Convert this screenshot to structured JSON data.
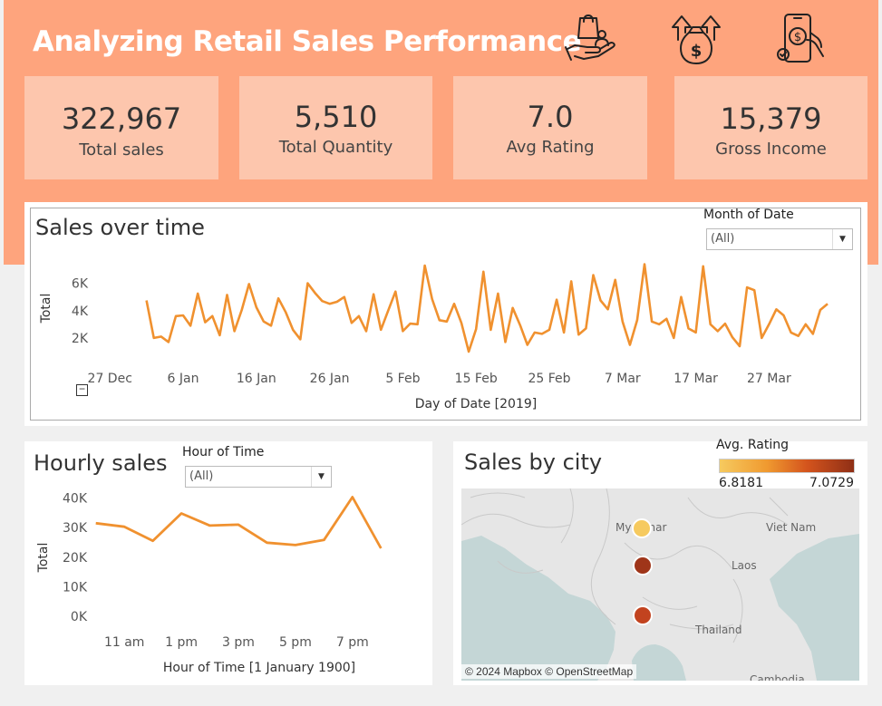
{
  "dashboard": {
    "title": "Analyzing Retail Sales Performance"
  },
  "header_icons": [
    "shopping-hand-icon",
    "money-growth-icon",
    "mobile-payment-icon"
  ],
  "kpis": [
    {
      "value": "322,967",
      "label": "Total sales"
    },
    {
      "value": "5,510",
      "label": "Total Quantity"
    },
    {
      "value": "7.0",
      "label": "Avg Rating"
    },
    {
      "value": "15,379",
      "label": "Gross Income"
    }
  ],
  "sales_panel": {
    "title": "Sales over time",
    "filter_label": "Month of Date",
    "filter_value": "(All)",
    "collapse_symbol": "−"
  },
  "hourly_panel": {
    "title": "Hourly sales",
    "filter_label": "Hour of Time",
    "filter_value": "(All)"
  },
  "map_panel": {
    "title": "Sales by city",
    "legend_title": "Avg. Rating",
    "legend_min": "6.8181",
    "legend_max": "7.0729",
    "attribution": "© 2024 Mapbox © OpenStreetMap",
    "labels": [
      "Myanmar",
      "Viet Nam",
      "Laos",
      "Thailand",
      "Cambodia"
    ],
    "cities": [
      {
        "rating": 6.8181,
        "color": "#f6ca5f"
      },
      {
        "rating": 7.0729,
        "color": "#9f3519"
      },
      {
        "rating": 7.0,
        "color": "#c2431f"
      }
    ]
  },
  "colors": {
    "accent": "#fea47d",
    "kpi_bg": "#fdc6ad",
    "line": "#f0912f",
    "map_water": "#c6d9d9",
    "map_land": "#e8e8e8"
  },
  "chart_data": [
    {
      "type": "line",
      "title": "Sales over time",
      "xlabel": "Day of Date [2019]",
      "ylabel": "Total",
      "x_tick_labels": [
        "27 Dec",
        "6 Jan",
        "16 Jan",
        "26 Jan",
        "5 Feb",
        "15 Feb",
        "25 Feb",
        "7 Mar",
        "17 Mar",
        "27 Mar"
      ],
      "x_tick_dates": [
        "2018-12-27",
        "2019-01-06",
        "2019-01-16",
        "2019-01-26",
        "2019-02-05",
        "2019-02-15",
        "2019-02-25",
        "2019-03-07",
        "2019-03-17",
        "2019-03-27"
      ],
      "y_tick_labels": [
        "2K",
        "4K",
        "6K"
      ],
      "y_ticks": [
        2000,
        4000,
        6000
      ],
      "x_range": [
        "2018-12-24",
        "2019-04-04"
      ],
      "ylim": [
        1000,
        7500
      ],
      "x_start": "2019-01-01",
      "values": [
        4750,
        2000,
        2100,
        1700,
        3600,
        3650,
        2900,
        5250,
        3150,
        3600,
        2200,
        5150,
        2500,
        4050,
        5950,
        4250,
        3200,
        2900,
        4900,
        3900,
        2600,
        1900,
        6000,
        5300,
        4700,
        4500,
        4650,
        5000,
        3100,
        3600,
        2500,
        5200,
        2600,
        4000,
        5400,
        2500,
        3050,
        3000,
        7300,
        4850,
        3300,
        3200,
        4500,
        3100,
        1000,
        2650,
        6850,
        2600,
        5250,
        1700,
        4200,
        2950,
        1500,
        2400,
        2300,
        2600,
        4800,
        2400,
        6150,
        2250,
        2700,
        6600,
        4750,
        4100,
        6250,
        3200,
        1500,
        3300,
        7400,
        3200,
        3000,
        3400,
        2000,
        5000,
        2700,
        2400,
        7250,
        3000,
        2500,
        3050,
        2050,
        1400,
        5700,
        5500,
        2000,
        3000,
        4100,
        3650,
        2400,
        2150,
        3000,
        2300,
        4050,
        4500
      ]
    },
    {
      "type": "line",
      "title": "Hourly sales",
      "xlabel": "Hour of Time [1 January 1900]",
      "ylabel": "Total",
      "x_tick_labels": [
        "11 am",
        "1 pm",
        "3 pm",
        "5 pm",
        "7 pm"
      ],
      "x_ticks": [
        11,
        13,
        15,
        17,
        19
      ],
      "y_tick_labels": [
        "0K",
        "10K",
        "20K",
        "30K",
        "40K"
      ],
      "y_ticks": [
        0,
        10000,
        20000,
        30000,
        40000
      ],
      "x": [
        10,
        11,
        12,
        13,
        14,
        15,
        16,
        17,
        18,
        19,
        20
      ],
      "values": [
        31500,
        30300,
        25500,
        34800,
        30700,
        31000,
        24900,
        24100,
        25800,
        40300,
        23000
      ],
      "xlim": [
        9.5,
        20.5
      ],
      "ylim": [
        0,
        42000
      ]
    }
  ]
}
